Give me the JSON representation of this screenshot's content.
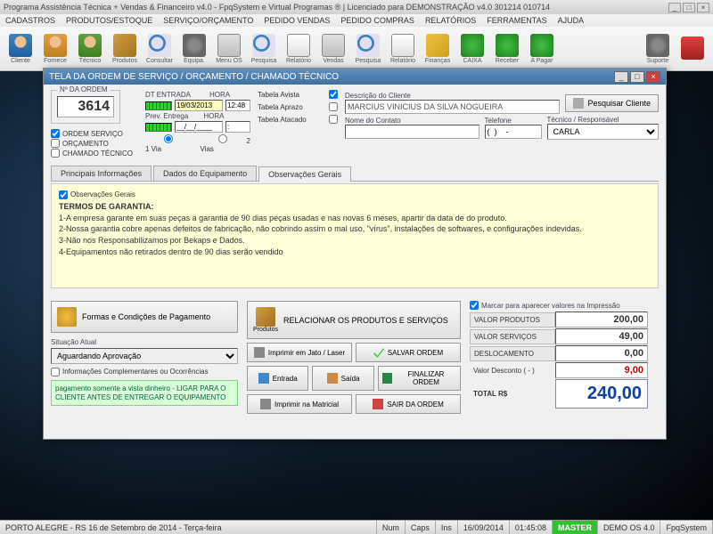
{
  "title": "Programa Assistência Técnica + Vendas & Financeiro v4.0 - FpqSystem e Virtual Programas ® | Licenciado para  DEMONSTRAÇÃO v4.0 301214 010714",
  "menu": [
    "CADASTROS",
    "PRODUTOS/ESTOQUE",
    "SERVIÇO/ORÇAMENTO",
    "PEDIDO VENDAS",
    "PEDIDO COMPRAS",
    "RELATÓRIOS",
    "FERRAMENTAS",
    "AJUDA"
  ],
  "toolbar": [
    "Cliente",
    "Fornece",
    "Técnico",
    "Produtos",
    "Consultar",
    "Equipa.",
    "Menu OS",
    "Pesquisa",
    "Relatório",
    "Vendas",
    "Pesquisa",
    "Relatório",
    "Finanças",
    "CAIXA",
    "Receber",
    "A Pagar",
    "Suporte",
    ""
  ],
  "win": {
    "title": "TELA DA ORDEM DE SERVIÇO / ORÇAMENTO / CHAMADO TÉCNICO",
    "order_lbl": "Nº DA ORDEM",
    "order_no": "3614",
    "chk_os": "ORDEM SERVIÇO",
    "chk_orc": "ORÇAMENTO",
    "chk_ct": "CHAMADO TÉCNICO",
    "dt_lbl": "DT ENTRADA",
    "hora_lbl": "HORA",
    "dt_val": "19/03/2013",
    "hora_val": "12:48",
    "prev_lbl": "Prev. Entrega",
    "prev_val": "__/__/____",
    "prev_hora": ":",
    "via1": "1 Via",
    "via2": "2 Vias",
    "tbl_avista": "Tabela Avista",
    "tbl_aprazo": "Tabela Aprazo",
    "tbl_atacado": "Tabela Atacado",
    "desc_cli_lbl": "Descrição do Cliente",
    "desc_cli": "MARCIUS VINICIUS DA SILVA NOGUEIRA",
    "nome_contato_lbl": "Nome do Contato",
    "tel_lbl": "Telefone",
    "tel_val": "(  )    -",
    "tecresp_lbl": "Técnico / Responsável",
    "tecresp": "CARLA",
    "pesq_cli": "Pesquisar Cliente",
    "tabs": [
      "Principais Informações",
      "Dados do Equipamento",
      "Observações Gerais"
    ],
    "obs_chk": "Observações Gerais",
    "obs_title": "TERMOS DE GARANTIA:",
    "obs_l1": "1-A empresa garante em suas peças a garantia de 90 dias peças usadas e nas novas 6 meses, apartir da data de do produto.",
    "obs_l2": "2-Nossa garantia cobre apenas defeitos de fabricação, não cobrindo assim o mal uso, \"vírus\",  instalações  de softwares, e configurações indevidas.",
    "obs_l3": "3-Não nos Responsabilizamos por Bekaps e Dados.",
    "obs_l4": "4-Equipamentos não retirados dentro de 90 dias serão vendido",
    "formas_pag": "Formas e Condições de Pagamento",
    "sit_lbl": "Situação Atual",
    "sit_val": "Aguardando Aprovação",
    "info_comp": "Informações Complementares ou Ocorrências",
    "note": "pagamento somente a vista dinheiro - LIGAR PARA O CLIENTE ANTES DE ENTREGAR O EQUIPAMENTO",
    "btn_rel": "RELACIONAR OS PRODUTOS E SERVIÇOS",
    "btn_rel_sub": "Produtos",
    "btn_print_laser": "Imprimir em Jato / Laser",
    "btn_salvar": "SALVAR ORDEM",
    "btn_entrada": "Entrada",
    "btn_saida": "Saída",
    "btn_finalizar": "FINALIZAR ORDEM",
    "btn_matricial": "Imprimir na Matricial",
    "btn_sair": "SAIR DA ORDEM",
    "mark": "Marcar para aparecer valores na Impressão",
    "v_prod_lbl": "VALOR PRODUTOS",
    "v_prod": "200,00",
    "v_serv_lbl": "VALOR SERVIÇOS",
    "v_serv": "49,00",
    "v_desl_lbl": "DESLOCAMENTO",
    "v_desl": "0,00",
    "v_desc_lbl": "Valor Desconto ( - )",
    "v_desc": "9,00",
    "v_tot_lbl": "TOTAL R$",
    "v_tot": "240,00"
  },
  "status": {
    "loc": "PORTO ALEGRE - RS 16 de Setembro de 2014 - Terça-feira",
    "num": "Num",
    "caps": "Caps",
    "ins": "Ins",
    "date": "16/09/2014",
    "time": "01:45:08",
    "master": "MASTER",
    "demo": "DEMO OS 4.0",
    "fpq": "FpqSystem"
  }
}
